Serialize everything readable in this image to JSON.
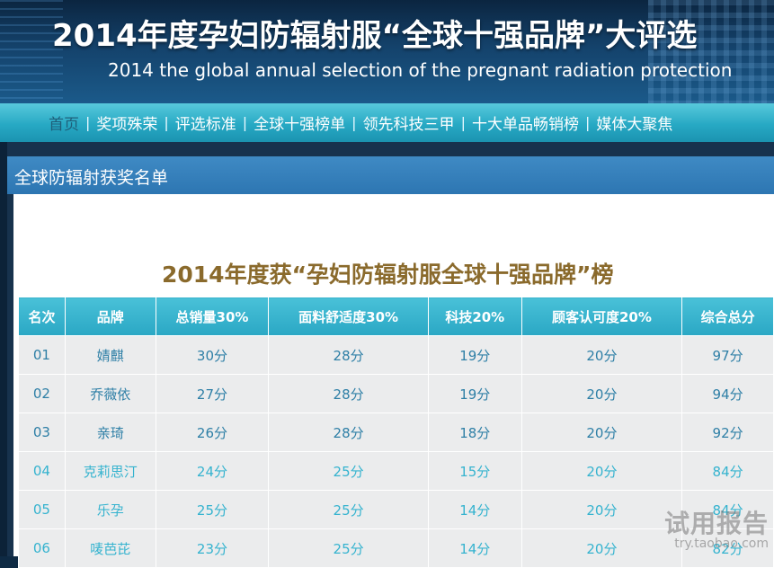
{
  "header": {
    "title_cn": "2014年度孕妇防辐射服“全球十强品牌”大评选",
    "title_en": "2014 the global annual selection of the pregnant radiation protection"
  },
  "nav": {
    "items": [
      {
        "label": "首页"
      },
      {
        "label": "奖项殊荣"
      },
      {
        "label": "评选标准"
      },
      {
        "label": "全球十强榜单"
      },
      {
        "label": "领先科技三甲"
      },
      {
        "label": "十大单品畅销榜"
      },
      {
        "label": "媒体大聚焦"
      }
    ],
    "separator": "|"
  },
  "section": {
    "title": "全球防辐射获奖名单"
  },
  "ranking": {
    "title": "2014年度获“孕妇防辐射服全球十强品牌”榜",
    "columns": [
      "名次",
      "品牌",
      "总销量30%",
      "面料舒适度30%",
      "科技20%",
      "顾客认可度20%",
      "综合总分"
    ],
    "rows": [
      [
        "01",
        "婧麒",
        "30分",
        "28分",
        "19分",
        "20分",
        "97分"
      ],
      [
        "02",
        "乔薇依",
        "27分",
        "28分",
        "19分",
        "20分",
        "94分"
      ],
      [
        "03",
        "亲琦",
        "26分",
        "28分",
        "18分",
        "20分",
        "92分"
      ],
      [
        "04",
        "克莉思汀",
        "24分",
        "25分",
        "15分",
        "20分",
        "84分"
      ],
      [
        "05",
        "乐孕",
        "25分",
        "25分",
        "14分",
        "20分",
        "84分"
      ],
      [
        "06",
        "唛芭芘",
        "23分",
        "25分",
        "14分",
        "20分",
        "82分"
      ]
    ]
  },
  "watermark": {
    "text": "试用报告",
    "url": "try.taobao.com"
  }
}
